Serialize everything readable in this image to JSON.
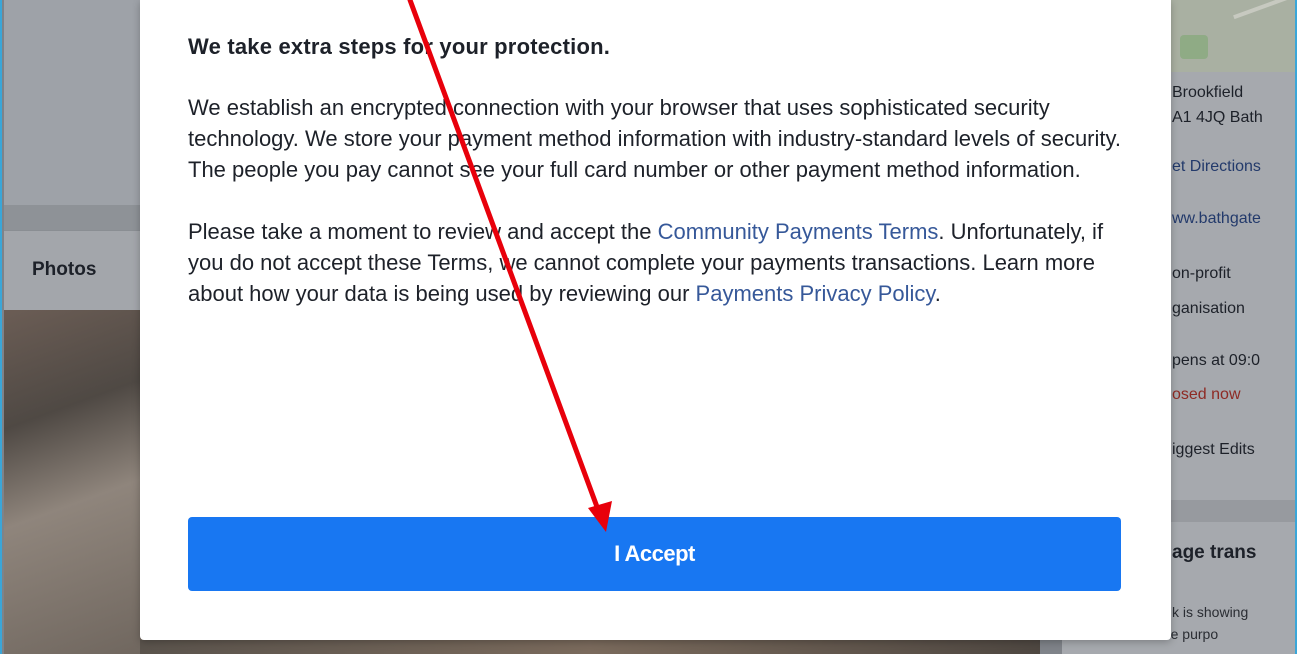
{
  "modal": {
    "title": "We take extra steps for your protection.",
    "paragraph1": "We establish an encrypted connection with your browser that uses sophisticated security technology. We store your payment method information with industry-standard levels of security. The people you pay cannot see your full card number or other payment method information.",
    "paragraph2_before": "Please take a moment to review and accept the ",
    "terms_link": "Community Payments Terms",
    "paragraph2_middle": ". Unfortunately, if you do not accept these Terms, we cannot complete your payments transactions. Learn more about how your data is being used by reviewing our ",
    "privacy_link": "Payments Privacy Policy",
    "paragraph2_end": ".",
    "accept_button": "I Accept"
  },
  "background": {
    "photos_label": "Photos",
    "right_panel": {
      "address1": "Brookfield",
      "address2": "A1 4JQ Bath",
      "directions": "et Directions",
      "website": "ww.bathgate",
      "category1": "on-profit",
      "category2": "ganisation",
      "hours": "pens at 09:0",
      "status": "osed now",
      "suggest": "iggest Edits",
      "section_title": "age trans",
      "section_text1": "k is showing",
      "section_text2": "understand the purpo"
    }
  },
  "colors": {
    "accent": "#1877f2",
    "link": "#365899",
    "annotation_arrow": "#e8000b",
    "frame_border": "#3aa6d8"
  }
}
